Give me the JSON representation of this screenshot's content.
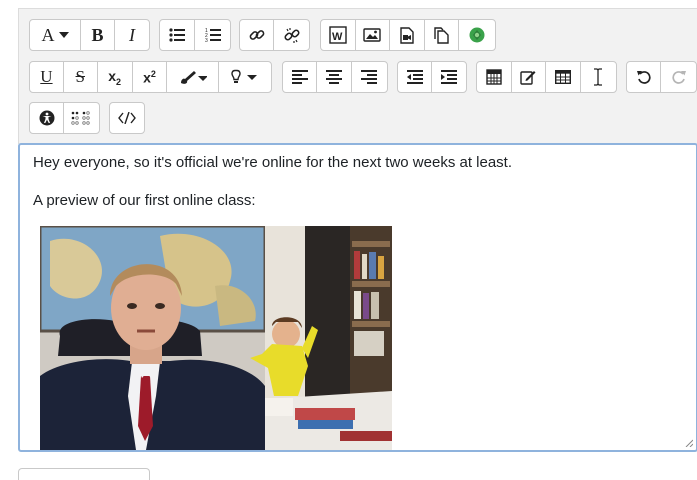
{
  "toolbar": {
    "row1": {
      "font_label": "A",
      "bold_label": "B",
      "italic_label": "I",
      "icons": [
        "font-format-dropdown-icon",
        "bold-icon",
        "italic-icon",
        "unordered-list-icon",
        "ordered-list-icon",
        "link-icon",
        "unlink-icon",
        "word-import-icon",
        "image-icon",
        "media-icon",
        "file-manager-icon",
        "copy-icon",
        "h5p-icon"
      ]
    },
    "row2": {
      "underline_label": "U",
      "strike_label": "S",
      "subscript_label": "x",
      "subscript_sub": "2",
      "superscript_label": "x",
      "superscript_sup": "2",
      "icons": [
        "underline-icon",
        "strikethrough-icon",
        "subscript-icon",
        "superscript-icon",
        "background-color-icon",
        "tip-icon",
        "align-left-icon",
        "align-center-icon",
        "align-right-icon",
        "outdent-icon",
        "indent-icon",
        "equation-icon",
        "edit-icon",
        "table-icon",
        "text-cursor-icon",
        "undo-icon",
        "redo-icon"
      ]
    },
    "row3": {
      "icons": [
        "accessibility-icon",
        "braille-icon",
        "html-source-icon"
      ]
    }
  },
  "editor": {
    "line1": "Hey everyone, so it's official we're online for the next two weeks at least.",
    "line2": "A preview of our first online class:",
    "image_description": "Embedded video still: man in suit at desk with child in yellow behind him"
  },
  "colors": {
    "toolbar_bg": "#f2f2f2",
    "editor_border": "#8fb3dd",
    "h5p_green": "#3aa24a"
  }
}
